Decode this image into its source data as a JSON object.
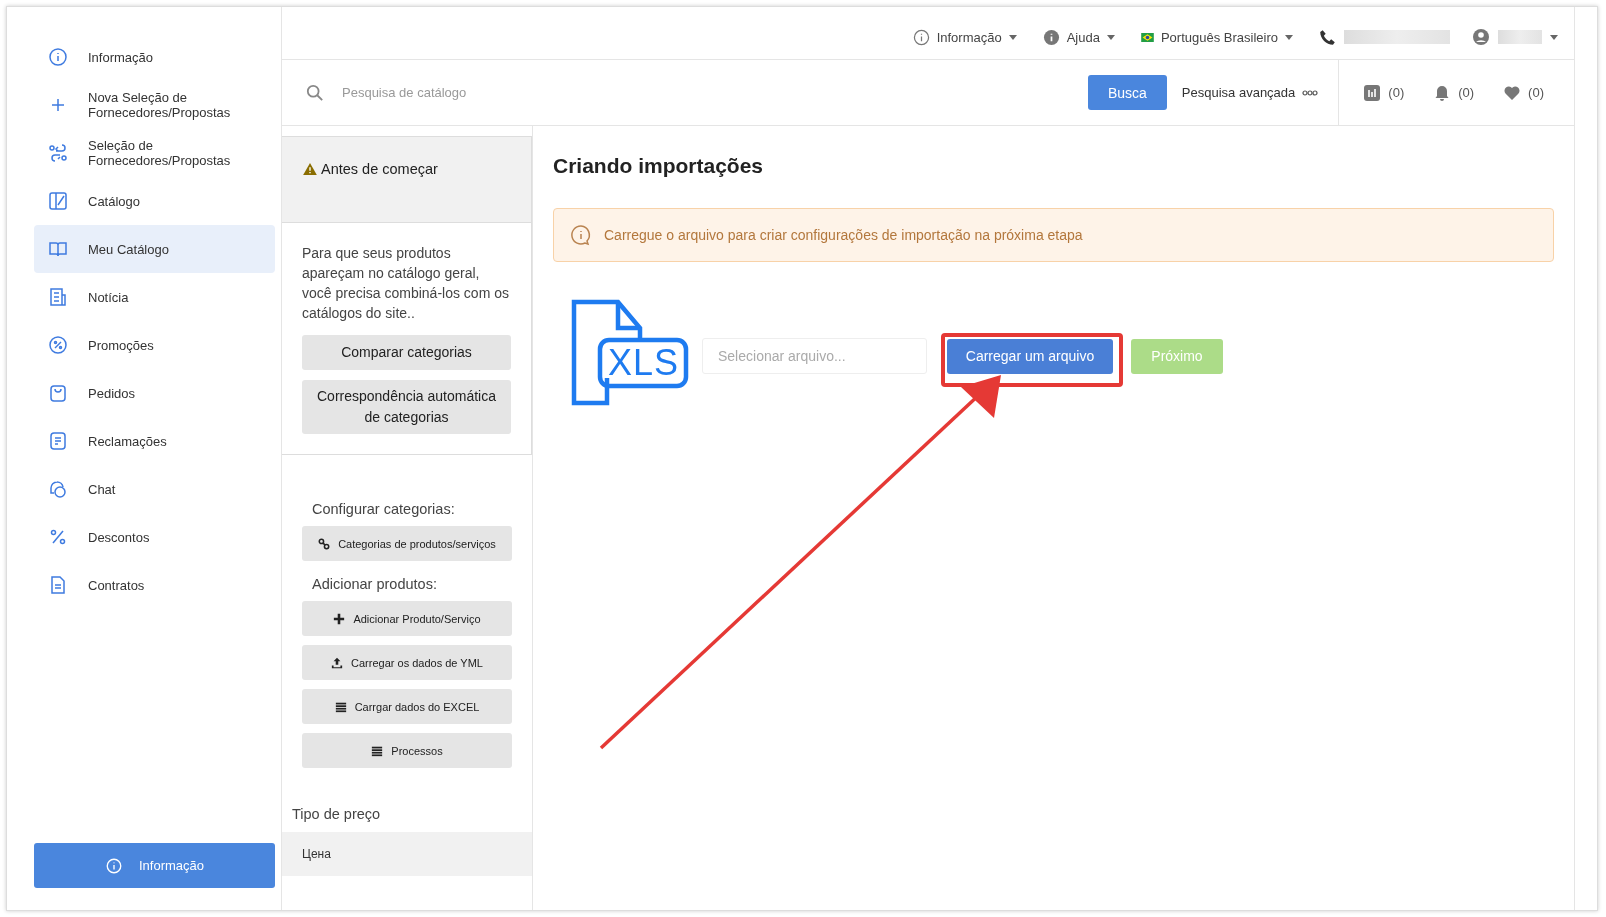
{
  "top_bar": {
    "menus": [
      {
        "kind": "info",
        "label": "Informação"
      },
      {
        "kind": "help",
        "label": "Ajuda"
      },
      {
        "kind": "language",
        "label": "Português Brasileiro"
      }
    ]
  },
  "search": {
    "placeholder": "Pesquisa de catálogo",
    "button": "Busca",
    "advanced": "Pesquisa avançada"
  },
  "counters": [
    {
      "kind": "compare",
      "count": "(0)"
    },
    {
      "kind": "notifications",
      "count": "(0)"
    },
    {
      "kind": "favorites",
      "count": "(0)"
    }
  ],
  "sidebar": {
    "items": [
      {
        "kind": "info",
        "label": "Informação",
        "selected": false
      },
      {
        "kind": "plus",
        "label": "Nova Seleção de Fornecedores/Propostas",
        "selected": false
      },
      {
        "kind": "swap",
        "label": "Seleção de Fornecedores/Propostas",
        "selected": false
      },
      {
        "kind": "catalog",
        "label": "Catálogo",
        "selected": false
      },
      {
        "kind": "book",
        "label": "Meu Catálogo",
        "selected": true
      },
      {
        "kind": "news",
        "label": "Notícia",
        "selected": false
      },
      {
        "kind": "promo",
        "label": "Promoções",
        "selected": false
      },
      {
        "kind": "bag",
        "label": "Pedidos",
        "selected": false
      },
      {
        "kind": "complaint",
        "label": "Reclamações",
        "selected": false
      },
      {
        "kind": "chat",
        "label": "Chat",
        "selected": false
      },
      {
        "kind": "percent",
        "label": "Descontos",
        "selected": false
      },
      {
        "kind": "doc",
        "label": "Contratos",
        "selected": false
      }
    ],
    "footer_button": "Informação"
  },
  "before_start": {
    "title": "Antes de começar",
    "text": "Para que seus produtos apareçam no catálogo geral, você precisa combiná-los com os catálogos do site..",
    "buttons": [
      "Comparar categorias",
      "Correspondência automática de categorias"
    ]
  },
  "configure": {
    "heading": "Configurar categorias:",
    "buttons": [
      {
        "kind": "link",
        "label": "Categorias de produtos/serviços"
      }
    ]
  },
  "add_products": {
    "heading": "Adicionar produtos:",
    "buttons": [
      {
        "kind": "plus",
        "label": "Adicionar Produto/Serviço"
      },
      {
        "kind": "upload",
        "label": "Carregar os dados de YML"
      },
      {
        "kind": "list",
        "label": "Carrgar dados do EXCEL"
      },
      {
        "kind": "list",
        "label": "Processos"
      }
    ]
  },
  "price_type": {
    "heading": "Tipo de preço",
    "items": [
      {
        "label": "Цена",
        "selected": true
      }
    ]
  },
  "import": {
    "title": "Criando importações",
    "notice": "Carregue o arquivo para criar configurações de importação na próxima etapa",
    "file_badge": "XLS",
    "file_field": {
      "placeholder": "Selecionar arquivo..."
    },
    "upload_button": "Carregar um arquivo",
    "next_button": {
      "label": "Próximo",
      "disabled": true
    }
  }
}
